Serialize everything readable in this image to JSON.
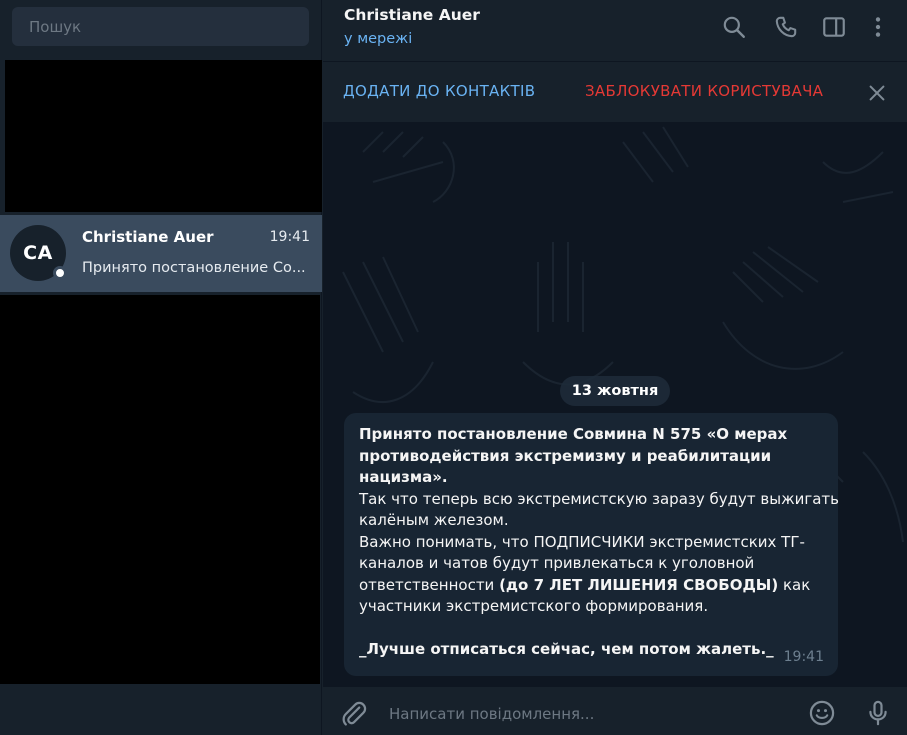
{
  "sidebar": {
    "search_placeholder": "Пошук",
    "chat": {
      "avatar_initials": "CA",
      "name": "Christiane Auer",
      "time": "19:41",
      "preview": "Принято постановление Со..."
    }
  },
  "header": {
    "name": "Christiane Auer",
    "status": "у мережі"
  },
  "action_bar": {
    "add_contact": "ДОДАТИ ДО КОНТАКТІВ",
    "block_user": "ЗАБЛОКУВАТИ КОРИСТУВАЧА"
  },
  "chat": {
    "date": "13 жовтня",
    "message": {
      "lines": [
        "Принято постановление Совмина N 575 «О мерах",
        "противодействия экстремизму и реабилитации",
        "нацизма».",
        " Так что теперь всю экстремистскую заразу будут выжигать",
        "калёным железом.",
        "Важно понимать, что ПОДПИСЧИКИ экстремистских ТГ-",
        "каналов и чатов будут привлекаться к уголовной",
        "ответственности ",
        "(до 7 ЛЕТ ЛИШЕНИЯ СВОБОДЫ)",
        " как",
        "участники экстремистского формирования.",
        "",
        "_Лучше отписаться сейчас, чем потом жалеть._"
      ],
      "time": "19:41"
    }
  },
  "composer": {
    "placeholder": "Написати повідомлення..."
  },
  "colors": {
    "sidebar_bg": "#17212b",
    "chat_bg": "#0e1621",
    "bubble_bg": "#182533",
    "accent": "#6ab3f3",
    "danger": "#e53935",
    "selected_chat": "#3a4b5e"
  }
}
